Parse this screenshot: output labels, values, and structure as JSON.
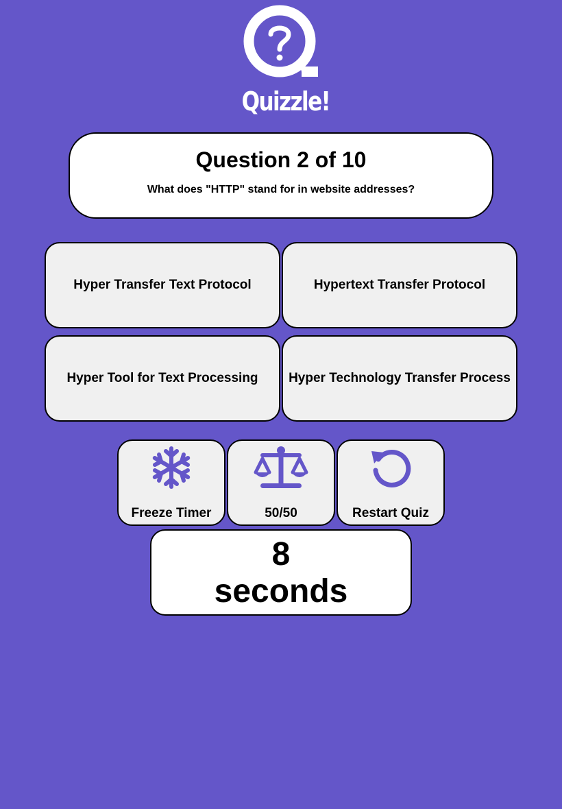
{
  "app": {
    "name": "Quizzle!",
    "logo_icon": "question-bubble-icon"
  },
  "question": {
    "title": "Question 2 of 10",
    "text": "What does \"HTTP\" stand for in website addresses?"
  },
  "answers": [
    {
      "label": "Hyper Transfer Text Protocol"
    },
    {
      "label": "Hypertext Transfer Protocol"
    },
    {
      "label": "Hyper Tool for Text Processing"
    },
    {
      "label": "Hyper Technology Transfer Process"
    }
  ],
  "tools": [
    {
      "label": "Freeze Timer",
      "icon": "snowflake-icon"
    },
    {
      "label": "50/50",
      "icon": "scales-icon"
    },
    {
      "label": "Restart Quiz",
      "icon": "restart-icon"
    }
  ],
  "timer": {
    "value": "8",
    "unit": "seconds"
  },
  "colors": {
    "background": "#6456c9",
    "accent": "#6456c9",
    "card": "#ffffff",
    "button": "#f0f0f0"
  }
}
